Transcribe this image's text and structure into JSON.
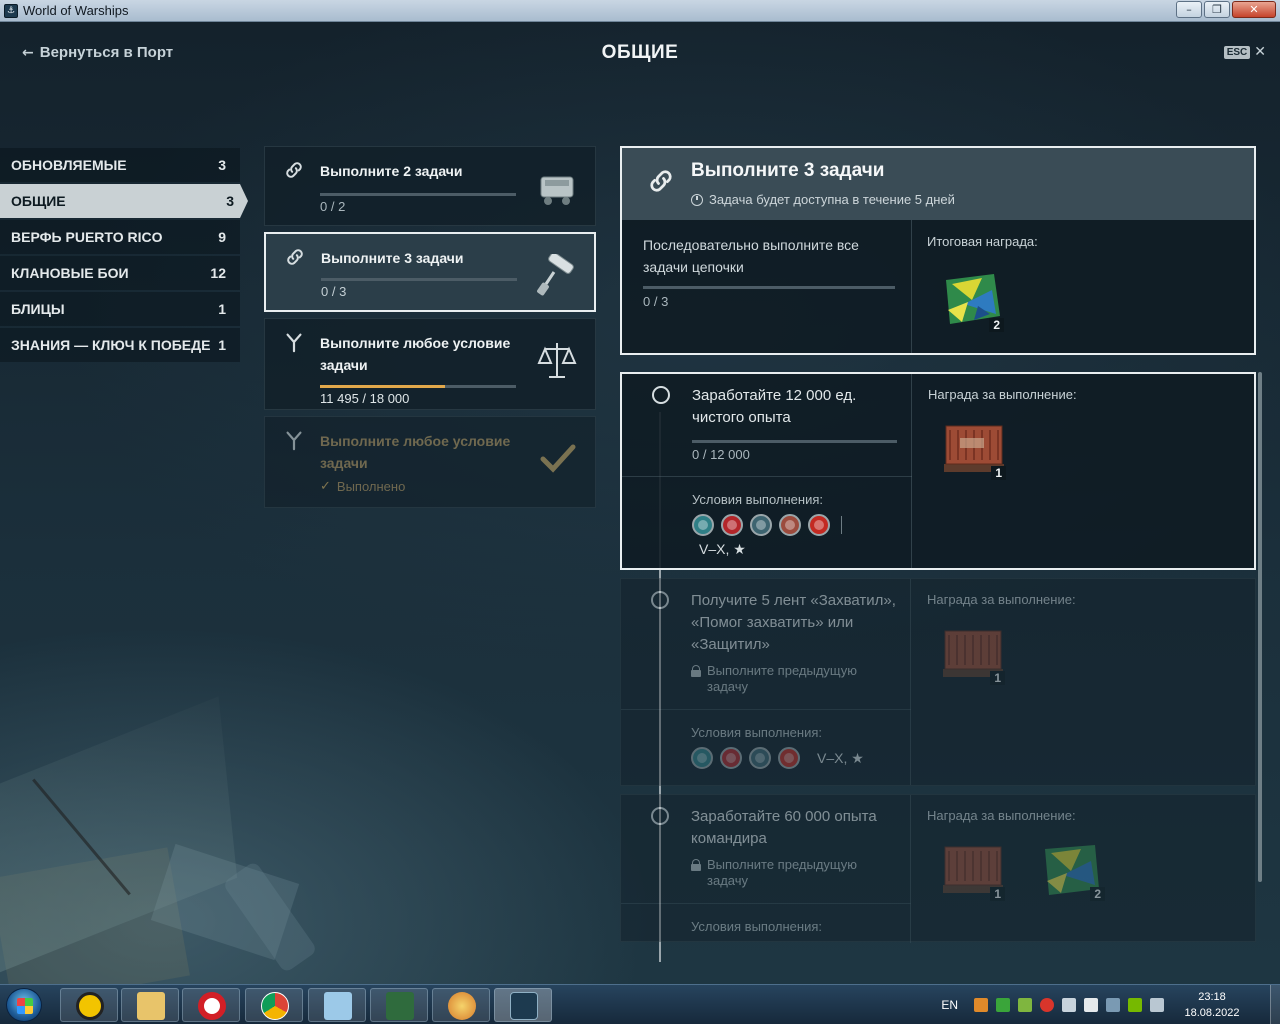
{
  "window": {
    "title": "World of Warships"
  },
  "header": {
    "back_label": "Вернуться в Порт",
    "page_title": "ОБЩИЕ",
    "esc_label": "ESC"
  },
  "sidebar": {
    "items": [
      {
        "label": "ОБНОВЛЯЕМЫЕ",
        "count": "3"
      },
      {
        "label": "ОБЩИЕ",
        "count": "3"
      },
      {
        "label": "ВЕРФЬ PUERTO RICO",
        "count": "9"
      },
      {
        "label": "КЛАНОВЫЕ БОИ",
        "count": "12"
      },
      {
        "label": "БЛИЦЫ",
        "count": "1"
      },
      {
        "label": "ЗНАНИЯ — КЛЮЧ К ПОБЕДЕ",
        "count": "1"
      }
    ]
  },
  "chains": [
    {
      "title": "Выполните 2 задачи",
      "progress": "0 / 2",
      "fraction": 0
    },
    {
      "title": "Выполните 3 задачи",
      "progress": "0 / 3",
      "fraction": 0
    },
    {
      "title": "Выполните любое условие задачи",
      "progress": "11 495 / 18 000",
      "fraction": 0.64
    },
    {
      "title": "Выполните любое условие задачи",
      "status": "Выполнено"
    }
  ],
  "detail": {
    "title": "Выполните 3 задачи",
    "availability": "Задача будет доступна в течение 5 дней",
    "description": "Последовательно выполните все задачи цепочки",
    "progress": "0 / 3",
    "final_reward_label": "Итоговая награда:",
    "final_reward_qty": "2"
  },
  "tasks": [
    {
      "title": "Заработайте 12 000 ед. чистого опыта",
      "progress": "0 / 12 000",
      "conditions_label": "Условия выполнения:",
      "tiers": "V–X, ★",
      "reward_label": "Награда за выполнение:",
      "reward_qty": "1"
    },
    {
      "title": "Получите 5 лент «Захватил», «Помог захватить» или «Защитил»",
      "lock_text": "Выполните предыдущую задачу",
      "conditions_label": "Условия выполнения:",
      "tiers": "V–X, ★",
      "reward_label": "Награда за выполнение:",
      "reward_qty": "1"
    },
    {
      "title": "Заработайте 60 000 опыта командира",
      "lock_text": "Выполните предыдущую задачу",
      "conditions_label": "Условия выполнения:",
      "reward_label": "Награда за выполнение:",
      "reward_qty_1": "1",
      "reward_qty_2": "2"
    }
  ],
  "taskbar": {
    "lang": "EN",
    "time": "23:18",
    "date": "18.08.2022"
  },
  "colors": {
    "accent_orange": "#e2a84b",
    "active_border": "#e9eef0",
    "done_text": "#8c7c56"
  }
}
